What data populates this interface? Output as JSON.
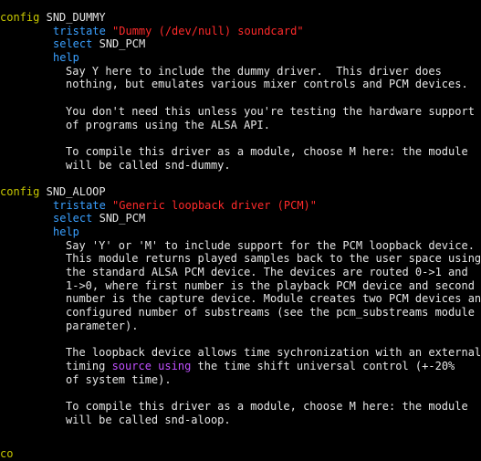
{
  "blocks": [
    {
      "config_kw": "config",
      "symbol": "SND_DUMMY",
      "tristate_kw": "tristate",
      "prompt": "\"Dummy (/dev/null) soundcard\"",
      "select_kw": "select",
      "select_value": "SND_PCM",
      "help_kw": "help",
      "help_lines": [
        {
          "segments": [
            {
              "text": "Say Y here to include the dummy driver.  This driver does",
              "style": "plain"
            }
          ]
        },
        {
          "segments": [
            {
              "text": "nothing, but emulates various mixer controls and PCM devices.",
              "style": "plain"
            }
          ]
        },
        {
          "segments": [
            {
              "text": "",
              "style": "plain"
            }
          ]
        },
        {
          "segments": [
            {
              "text": "You don't need this unless you're testing the hardware support",
              "style": "plain"
            }
          ]
        },
        {
          "segments": [
            {
              "text": "of programs using the ALSA API.",
              "style": "plain"
            }
          ]
        },
        {
          "segments": [
            {
              "text": "",
              "style": "plain"
            }
          ]
        },
        {
          "segments": [
            {
              "text": "To compile this driver as a module, choose M here: the module",
              "style": "plain"
            }
          ]
        },
        {
          "segments": [
            {
              "text": "will be called snd-dummy.",
              "style": "plain"
            }
          ]
        }
      ]
    },
    {
      "config_kw": "config",
      "symbol": "SND_ALOOP",
      "tristate_kw": "tristate",
      "prompt": "\"Generic loopback driver (PCM)\"",
      "select_kw": "select",
      "select_value": "SND_PCM",
      "help_kw": "help",
      "help_lines": [
        {
          "segments": [
            {
              "text": "Say 'Y' or 'M' to include support for the PCM loopback device.",
              "style": "plain"
            }
          ]
        },
        {
          "segments": [
            {
              "text": "This module returns played samples back to the user space using",
              "style": "plain"
            }
          ]
        },
        {
          "segments": [
            {
              "text": "the standard ALSA PCM device. The devices are routed 0->1 and",
              "style": "plain"
            }
          ]
        },
        {
          "segments": [
            {
              "text": "1->0, where first number is the playback PCM device and second",
              "style": "plain"
            }
          ]
        },
        {
          "segments": [
            {
              "text": "number is the capture device. Module creates two PCM devices and",
              "style": "plain"
            }
          ]
        },
        {
          "segments": [
            {
              "text": "configured number of substreams (see the pcm_substreams module",
              "style": "plain"
            }
          ]
        },
        {
          "segments": [
            {
              "text": "parameter).",
              "style": "plain"
            }
          ]
        },
        {
          "segments": [
            {
              "text": "",
              "style": "plain"
            }
          ]
        },
        {
          "segments": [
            {
              "text": "The loopback device allows time sychronization with an external",
              "style": "plain"
            }
          ]
        },
        {
          "segments": [
            {
              "text": "timing ",
              "style": "plain"
            },
            {
              "text": "source",
              "style": "special"
            },
            {
              "text": " ",
              "style": "plain"
            },
            {
              "text": "using",
              "style": "special"
            },
            {
              "text": " the time shift universal control (+-20%",
              "style": "plain"
            }
          ]
        },
        {
          "segments": [
            {
              "text": "of system time).",
              "style": "plain"
            }
          ]
        },
        {
          "segments": [
            {
              "text": "",
              "style": "plain"
            }
          ]
        },
        {
          "segments": [
            {
              "text": "To compile this driver as a module, choose M here: the module",
              "style": "plain"
            }
          ]
        },
        {
          "segments": [
            {
              "text": "will be called snd-aloop.",
              "style": "plain"
            }
          ]
        }
      ]
    }
  ],
  "trailing_partial": "co",
  "colors": {
    "background": "#000000",
    "config_keyword": "#c8c800",
    "attribute_keyword": "#3aa0ff",
    "string": "#ff2a2a",
    "special_keyword": "#c050ff",
    "text": "#e6e6e6"
  }
}
